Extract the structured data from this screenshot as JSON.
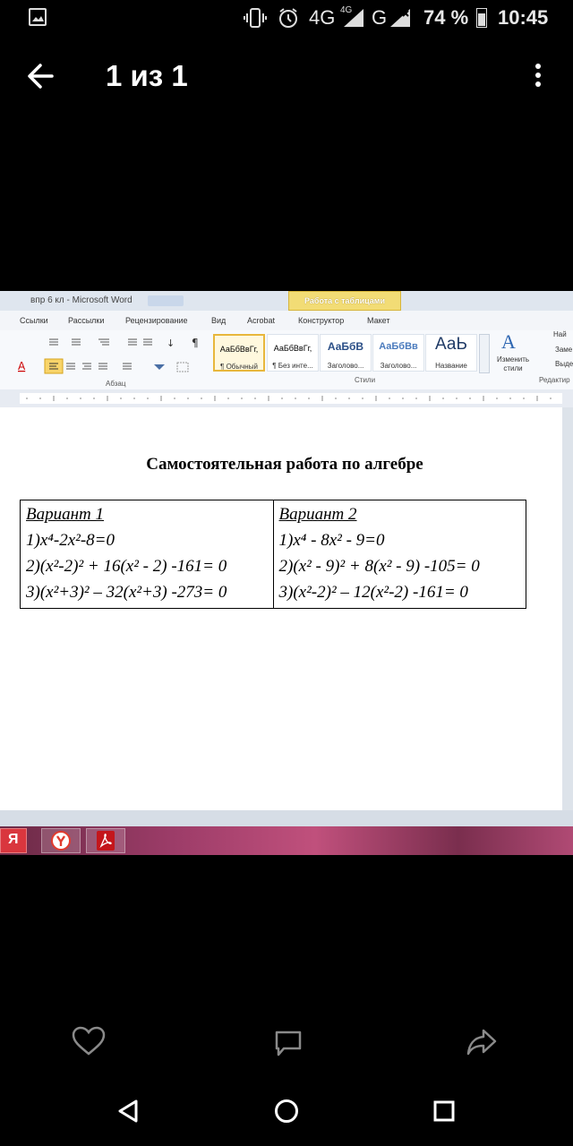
{
  "status_bar": {
    "network": "4G",
    "network_small": "4G",
    "carrier_g": "G",
    "battery": "74 %",
    "time": "10:45"
  },
  "app_bar": {
    "title": "1 из 1"
  },
  "word": {
    "window_title": "впр 6 кл  -  Microsoft Word",
    "context_tab": "Работа с таблицами",
    "tabs": [
      "Ссылки",
      "Рассылки",
      "Рецензирование",
      "Вид",
      "Acrobat",
      "Конструктор",
      "Макет"
    ],
    "styles": [
      {
        "preview": "АаБбВвГг,",
        "name": "¶ Обычный"
      },
      {
        "preview": "АаБбВвГг,",
        "name": "¶ Без инте..."
      },
      {
        "preview": "АаБбВ",
        "name": "Заголово..."
      },
      {
        "preview": "АаБбВв",
        "name": "Заголово..."
      },
      {
        "preview": "АаЬ",
        "name": "Название"
      }
    ],
    "change_styles": "Изменить стили",
    "groups": {
      "paragraph": "Абзац",
      "styles": "Стили",
      "editing": "Редактир"
    },
    "find": "Най",
    "replace": "Заме",
    "select": "Выде"
  },
  "document": {
    "heading": "Самостоятельная работа по алгебре",
    "variants": [
      {
        "title": "Вариант 1",
        "lines": [
          "1)x⁴-2x²-8=0",
          "2)(x²-2)² + 16(x² - 2) -161= 0",
          "3)(x²+3)² – 32(x²+3) -273= 0"
        ]
      },
      {
        "title": "Вариант 2",
        "lines": [
          "1)x⁴ - 8x² - 9=0",
          "2)(x² - 9)² + 8(x² - 9) -105= 0",
          "3)(x²-2)² – 12(x²-2) -161= 0"
        ]
      }
    ]
  },
  "taskbar": {
    "yandex_label": "Я"
  }
}
